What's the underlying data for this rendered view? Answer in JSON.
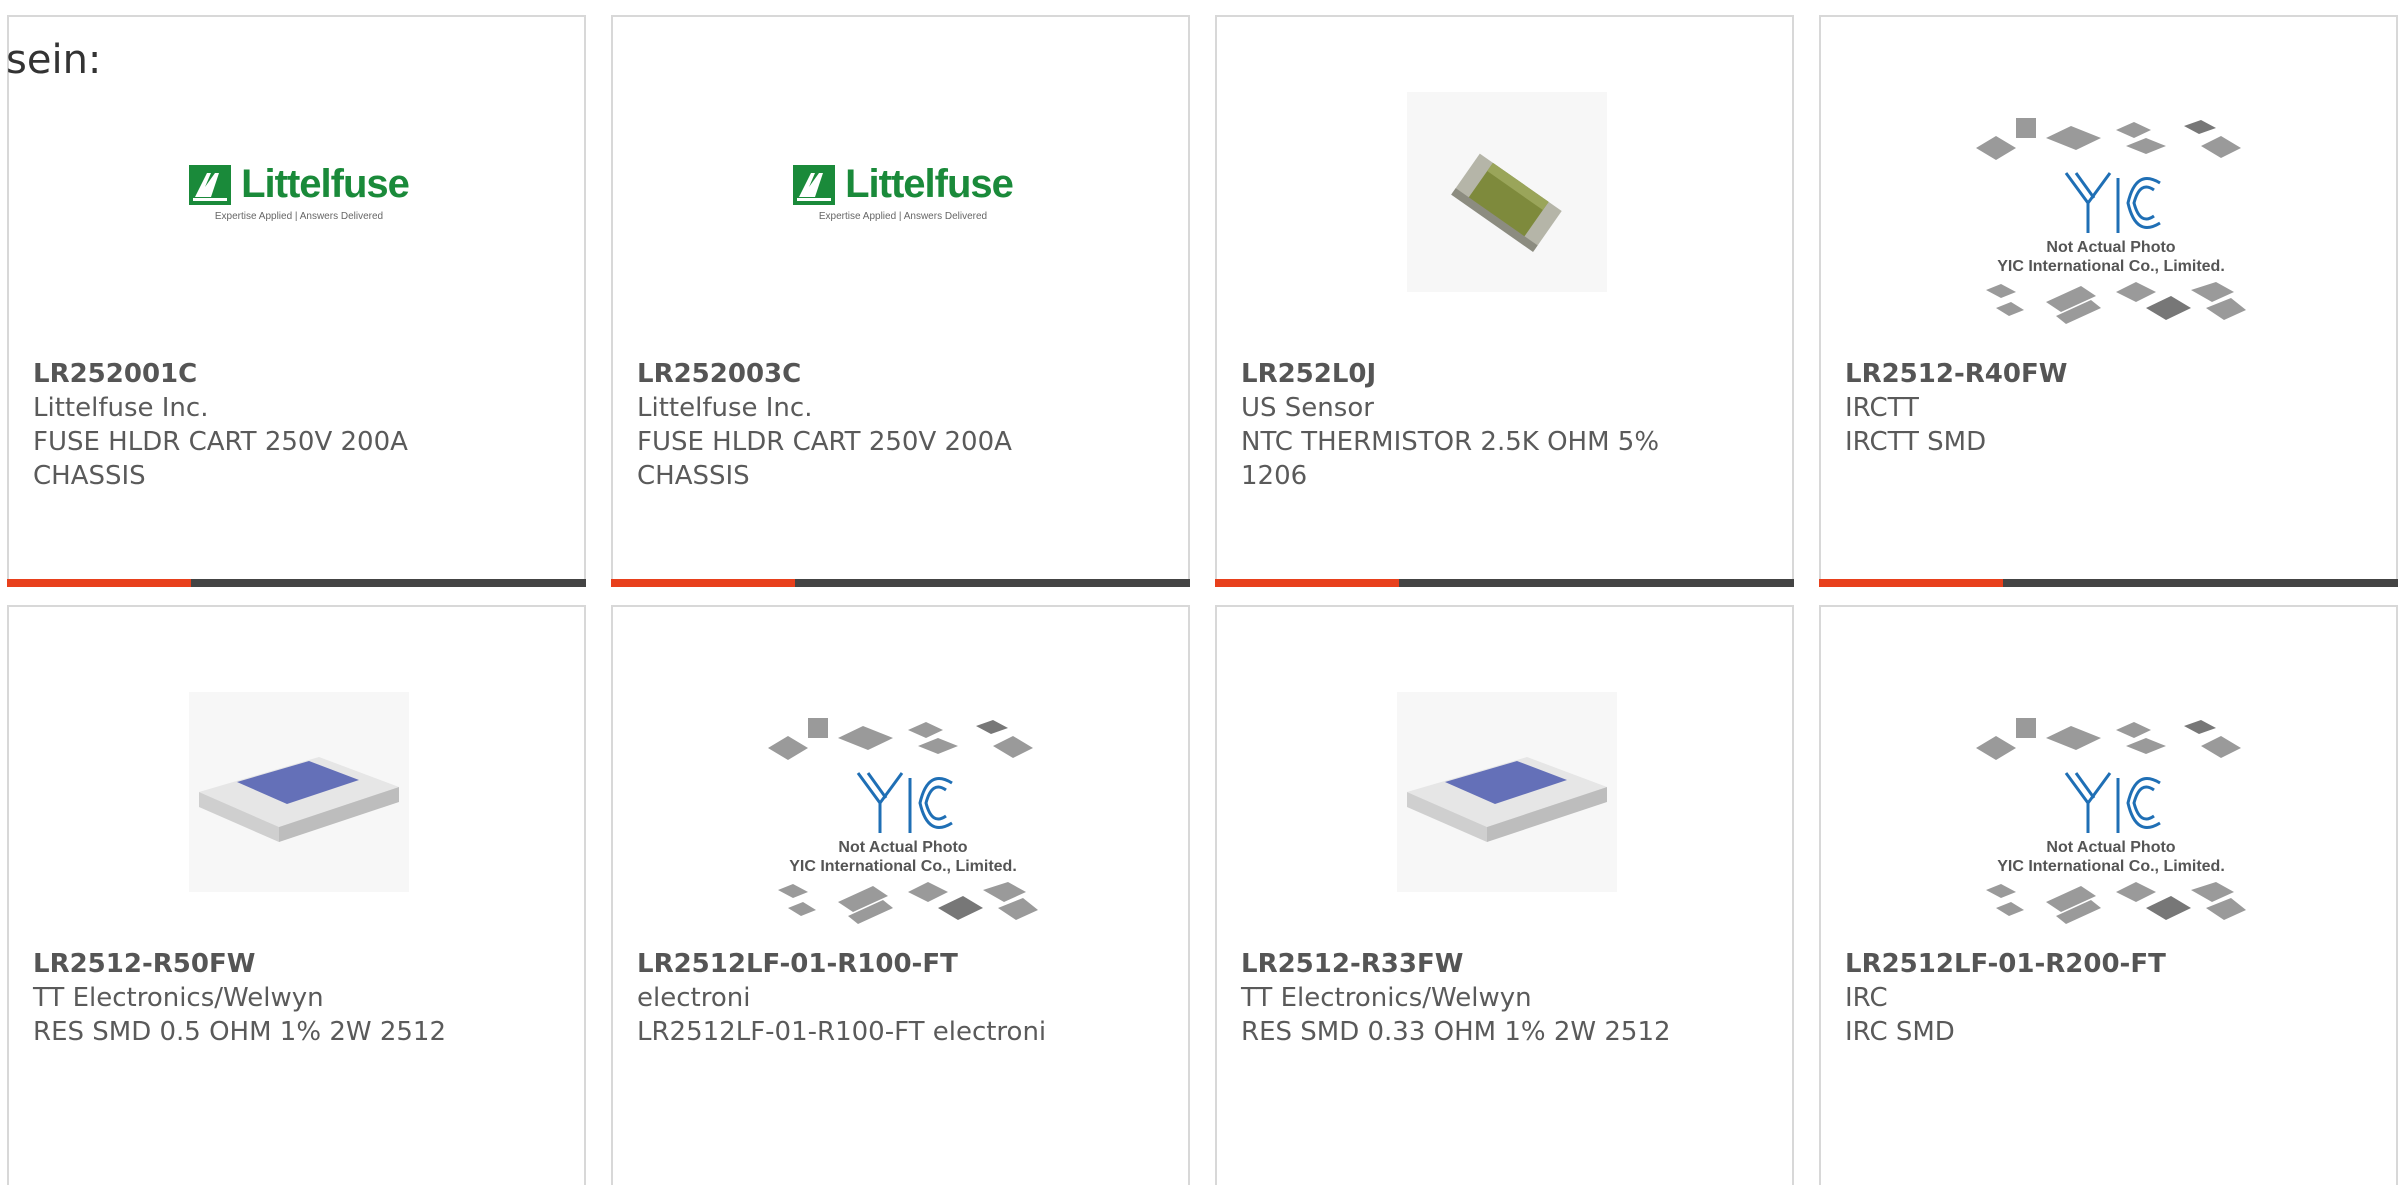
{
  "lead_text": "sein:",
  "products": [
    {
      "part": "LR252001C",
      "maker": "Littelfuse Inc.",
      "desc": [
        "FUSE HLDR CART 250V 200A",
        "CHASSIS"
      ],
      "image": "littelfuse-logo"
    },
    {
      "part": "LR252003C",
      "maker": "Littelfuse Inc.",
      "desc": [
        "FUSE HLDR CART 250V 200A",
        "CHASSIS"
      ],
      "image": "littelfuse-logo"
    },
    {
      "part": "LR252L0J",
      "maker": "US Sensor",
      "desc": [
        "NTC THERMISTOR 2.5K OHM 5%",
        "1206"
      ],
      "image": "thermistor-chip"
    },
    {
      "part": "LR2512-R40FW",
      "maker": "IRCTT",
      "desc": [
        "IRCTT SMD",
        ""
      ],
      "image": "yic-placeholder"
    },
    {
      "part": "LR2512-R50FW",
      "maker": "TT Electronics/Welwyn",
      "desc": [
        "RES SMD 0.5 OHM 1% 2W 2512",
        ""
      ],
      "image": "smd-resistor"
    },
    {
      "part": "LR2512LF-01-R100-FT",
      "maker": "electroni",
      "desc": [
        "LR2512LF-01-R100-FT electroni",
        ""
      ],
      "image": "yic-placeholder"
    },
    {
      "part": "LR2512-R33FW",
      "maker": "TT Electronics/Welwyn",
      "desc": [
        "RES SMD 0.33 OHM 1% 2W 2512",
        ""
      ],
      "image": "smd-resistor"
    },
    {
      "part": "LR2512LF-01-R200-FT",
      "maker": "IRC",
      "desc": [
        "IRC SMD",
        ""
      ],
      "image": "yic-placeholder"
    }
  ],
  "logos": {
    "littelfuse_name": "Littelfuse",
    "littelfuse_tagline": "Expertise Applied | Answers Delivered",
    "yic_line1": "Not Actual Photo",
    "yic_line2": "YIC International Co., Limited."
  },
  "colors": {
    "accent": "#e8401c",
    "bar": "#444444",
    "littelfuse_green": "#1a8a3a",
    "yic_blue": "#1f6fb5"
  }
}
